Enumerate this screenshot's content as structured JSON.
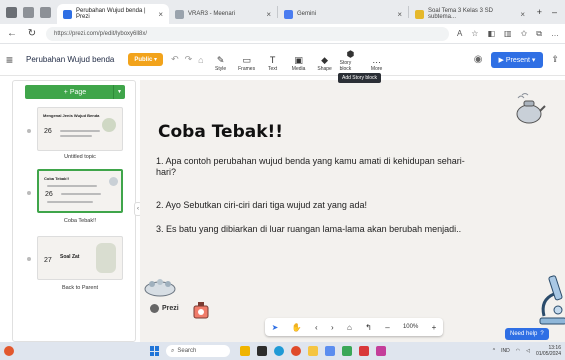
{
  "browser": {
    "tabs": [
      {
        "label": "Perubahan Wujud benda | Prezi",
        "active": true,
        "color": "#2f6fe4"
      },
      {
        "label": "VRAR3 - Meenari",
        "active": false,
        "color": "#9aa3ad"
      },
      {
        "label": "Gemini",
        "active": false,
        "color": "#4a7cf0"
      },
      {
        "label": "Soal Tema 3 Kelas 3 SD subtema...",
        "active": false,
        "color": "#e5b82b"
      }
    ],
    "url": "https://prezi.com/p/edit/lyboxy6ll8x/"
  },
  "app": {
    "doc_title": "Perubahan Wujud benda",
    "public_label": "Public",
    "tools": [
      {
        "label": "Style",
        "icon": "pen-icon"
      },
      {
        "label": "Frames",
        "icon": "frame-icon"
      },
      {
        "label": "Text",
        "icon": "text-icon"
      },
      {
        "label": "Media",
        "icon": "media-icon"
      },
      {
        "label": "Shape",
        "icon": "shape-icon"
      },
      {
        "label": "Story block",
        "icon": "storyblock-icon"
      },
      {
        "label": "More",
        "icon": "more-icon"
      }
    ],
    "tooltip": "Add Story block",
    "present_label": "Present",
    "accent": "#2f6fe4",
    "public_color": "#f2a31b",
    "page_button_color": "#3fa54a"
  },
  "panel": {
    "add_page_label": "+ Page",
    "slides": [
      {
        "title": "Mengenal Jenis Wujud Benda",
        "number": "26",
        "label": "Untitled topic"
      },
      {
        "title": "Coba Tebak!!",
        "number": "26",
        "label": "Coba Tebak!!"
      },
      {
        "title": "Soal Zat",
        "number": "27",
        "label": "Back to Parent"
      }
    ]
  },
  "slide": {
    "title": "Coba Tebak!!",
    "questions": [
      "1. Apa contoh perubahan wujud benda yang kamu amati di kehidupan sehari-hari?",
      "2. Ayo Sebutkan ciri-ciri dari tiga wujud zat yang ada!",
      "3. Es batu yang dibiarkan di luar ruangan lama-lama akan berubah menjadi.."
    ]
  },
  "canvas_toolbar": {
    "zoom": "100%"
  },
  "footer": {
    "prezi_label": "Prezi",
    "need_help_label": "Need help"
  },
  "taskbar": {
    "search_placeholder": "Search",
    "time": "13:16",
    "date": "01/05/2024",
    "language": "IND"
  }
}
